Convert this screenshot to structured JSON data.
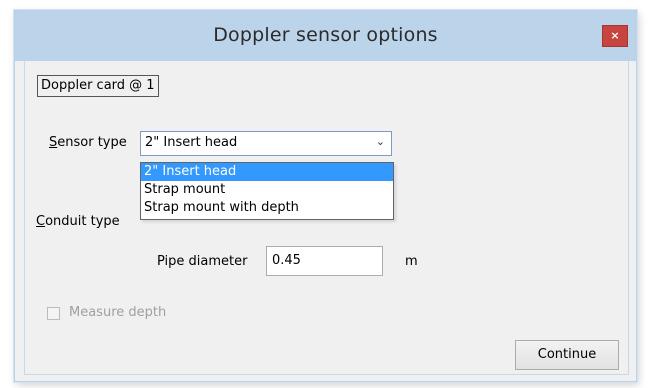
{
  "window": {
    "title": "Doppler sensor options",
    "close_glyph": "×"
  },
  "card": {
    "label": "Doppler card @ 1"
  },
  "sensor_type": {
    "label": "Sensor type",
    "value": "2\" Insert head",
    "arrow_icon": "chevron-down-icon",
    "options": [
      "2\" Insert head",
      "Strap mount",
      "Strap mount with depth"
    ],
    "selected_index": 0
  },
  "conduit_type": {
    "label": "Conduit type"
  },
  "pipe_diameter": {
    "label": "Pipe diameter",
    "value": "0.45",
    "unit": "m"
  },
  "measure_depth": {
    "label": "Measure depth",
    "checked": false,
    "enabled": false
  },
  "buttons": {
    "continue_label": "Continue"
  },
  "colors": {
    "titlebar": "#bcd4ea",
    "close_button": "#c7453e",
    "selection_highlight": "#3399ff",
    "disabled_text": "#a0a0a0"
  }
}
